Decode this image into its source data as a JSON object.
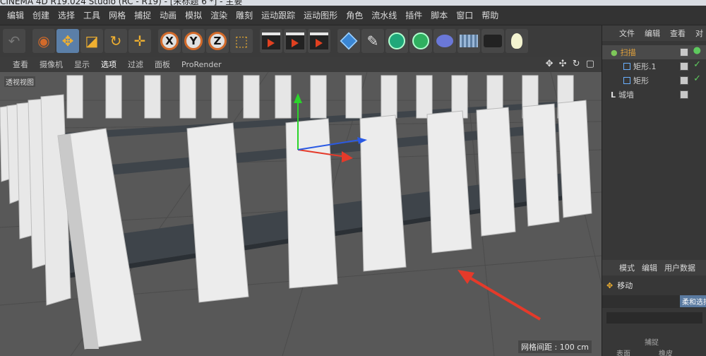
{
  "window": {
    "title": "CINEMA 4D R19.024 Studio (RC - R19) - [未标题 6 *] - 主要"
  },
  "menu": [
    "编辑",
    "创建",
    "选择",
    "工具",
    "网格",
    "捕捉",
    "动画",
    "模拟",
    "渲染",
    "雕刻",
    "运动跟踪",
    "运动图形",
    "角色",
    "流水线",
    "插件",
    "脚本",
    "窗口",
    "帮助"
  ],
  "toolbar": {
    "tools": [
      {
        "icon": "select-icon",
        "active": false
      },
      {
        "icon": "move-icon",
        "active": true
      },
      {
        "icon": "scale-icon",
        "active": false
      },
      {
        "icon": "rotate-icon",
        "active": false
      },
      {
        "icon": "recent-tool-icon",
        "active": false
      }
    ],
    "axes": [
      "X",
      "Y",
      "Z"
    ],
    "axis_icons": [
      "x-axis-icon",
      "y-axis-icon",
      "z-axis-icon"
    ],
    "render_icons": [
      "render-view-icon",
      "render-picture-viewer-icon",
      "render-settings-icon"
    ],
    "create_icons": [
      "cube-icon",
      "pen-icon",
      "subdivision-icon",
      "array-icon",
      "deformer-icon",
      "floor-icon",
      "camera-icon",
      "light-icon"
    ]
  },
  "viewport": {
    "menu": [
      "查看",
      "摄像机",
      "显示",
      "选项",
      "过滤",
      "面板",
      "ProRender"
    ],
    "active_menu": "选项",
    "label": "透视视图",
    "grid_info": "网格间距 : 100 cm",
    "nav_icons": [
      "move-view-icon",
      "zoom-view-icon",
      "rotate-view-icon",
      "maximize-view-icon"
    ],
    "colors": {
      "background": "#585858",
      "pillar": "#e8e8e8",
      "beam": "#3e444a",
      "arrow": "#e53a2a"
    }
  },
  "object_manager": {
    "menu": [
      "文件",
      "编辑",
      "查看",
      "对"
    ],
    "objects": [
      {
        "name": "扫描",
        "level": 0,
        "color": "#e3a23b"
      },
      {
        "name": "矩形.1",
        "level": 1,
        "color": "#d8d8d8"
      },
      {
        "name": "矩形",
        "level": 1,
        "color": "#d8d8d8"
      },
      {
        "name": "城墙",
        "level": 0,
        "color": "#d8d8d8"
      }
    ]
  },
  "attribute_manager": {
    "menu": [
      "模式",
      "编辑",
      "用户数据"
    ],
    "tool_name": "移动",
    "tab_label": "柔和选择",
    "row_labels": [
      [
        "",
        "捕捉"
      ],
      [
        "表面",
        "橡皮"
      ]
    ]
  }
}
